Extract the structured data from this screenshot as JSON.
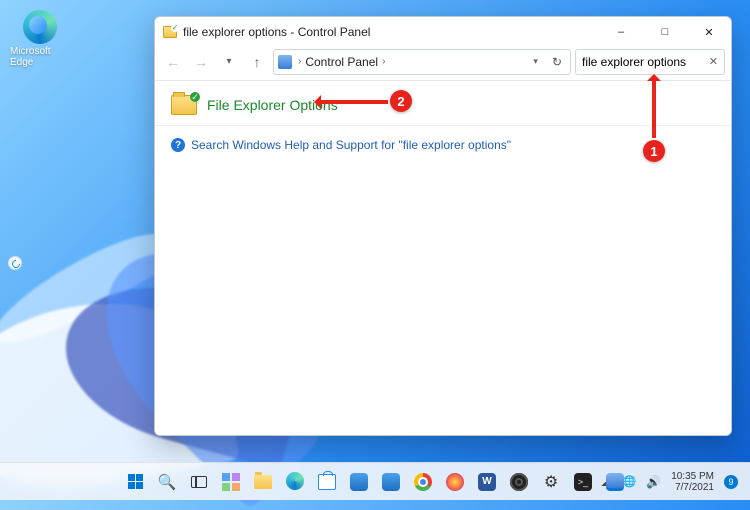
{
  "desktop": {
    "edge_label": "Microsoft Edge"
  },
  "window": {
    "title": "file explorer options - Control Panel",
    "breadcrumb": {
      "root": "Control Panel"
    },
    "search": {
      "value": "file explorer options"
    },
    "result": {
      "label": "File Explorer Options"
    },
    "help": {
      "text": "Search Windows Help and Support for \"file explorer options\""
    }
  },
  "annotations": {
    "callout1": "1",
    "callout2": "2"
  },
  "taskbar": {
    "time": "10:35 PM",
    "date": "7/7/2021",
    "notif_count": "9"
  }
}
